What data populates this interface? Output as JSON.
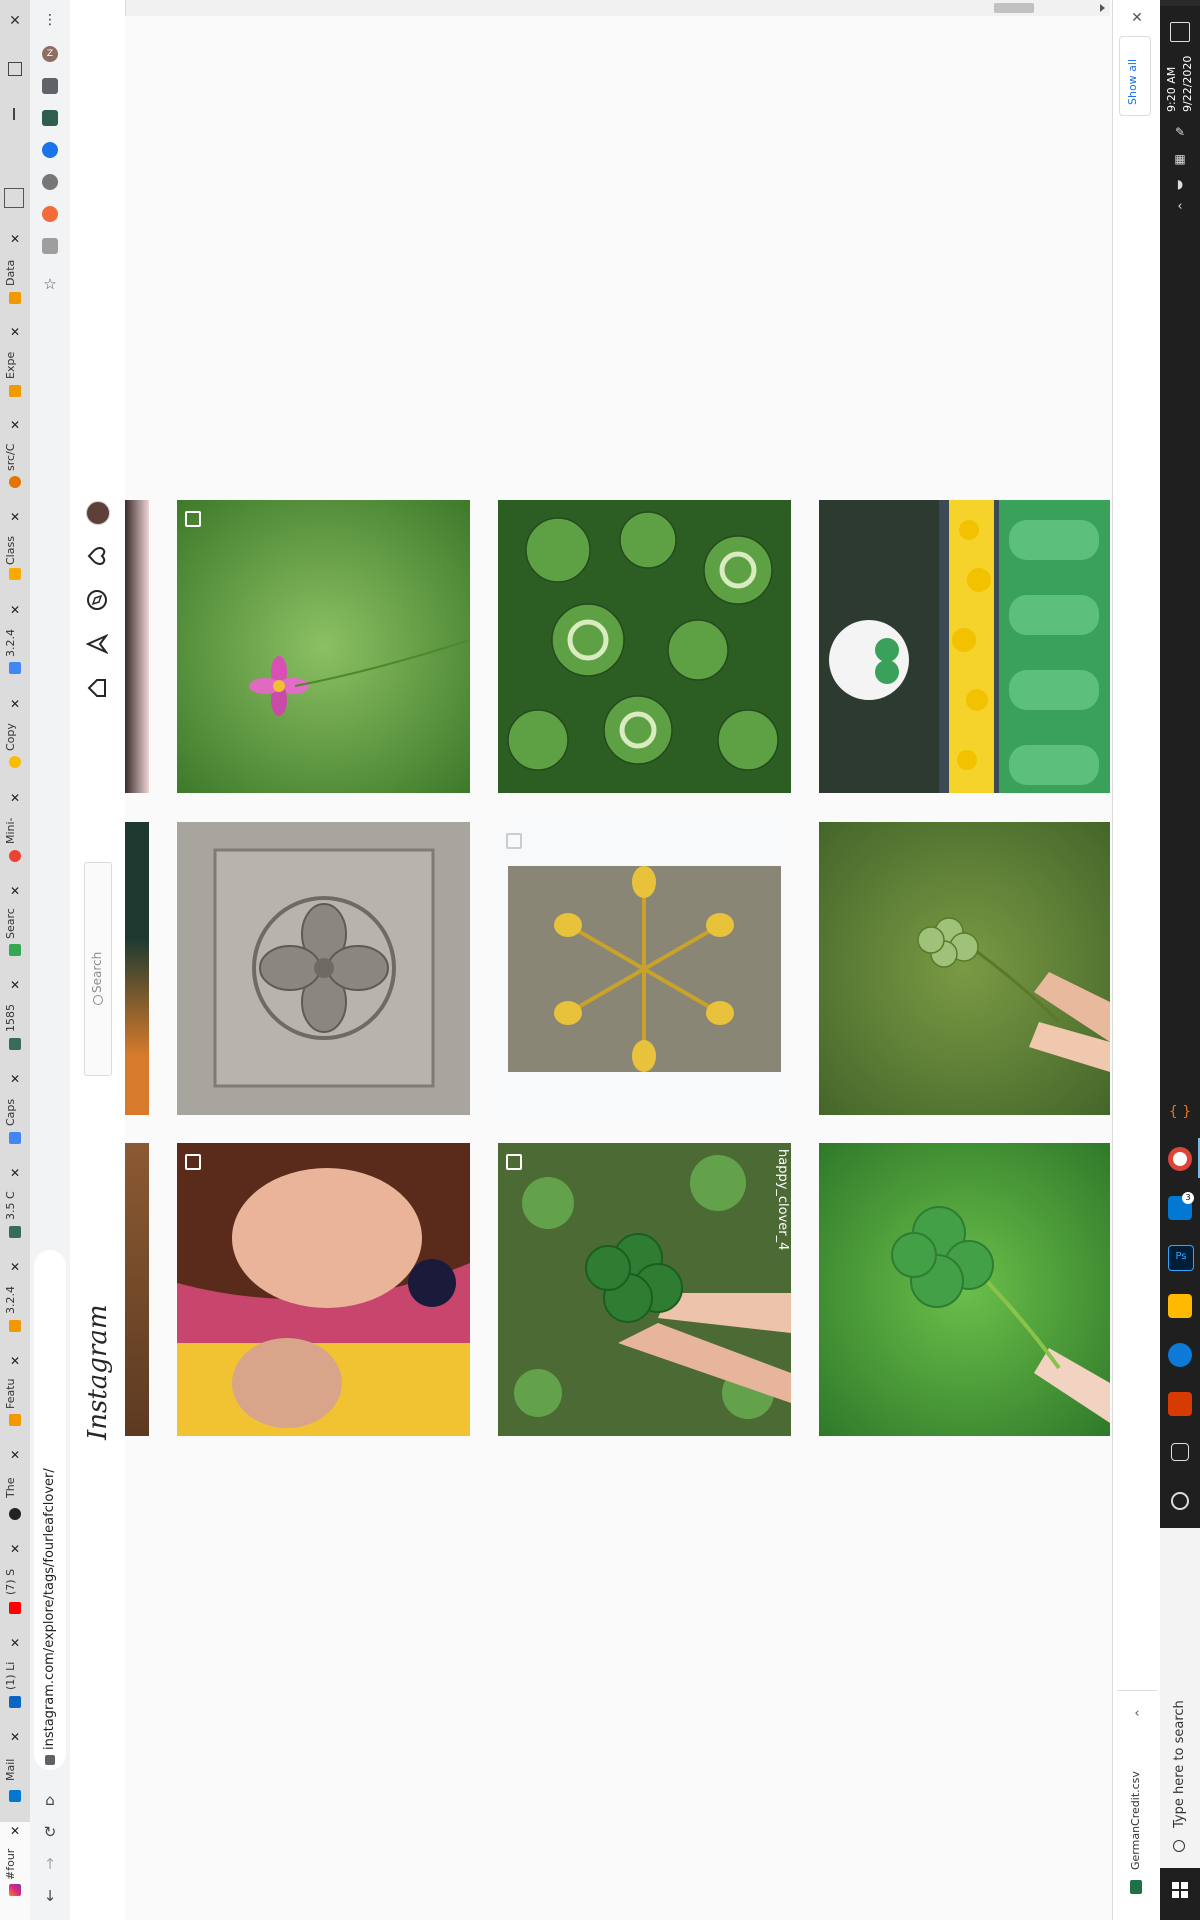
{
  "browser": {
    "url": "instagram.com/explore/tags/fourleafclover/",
    "tabs": [
      {
        "label": "#four"
      },
      {
        "label": "Mail"
      },
      {
        "label": "(1) Li"
      },
      {
        "label": "(7) S"
      },
      {
        "label": "The"
      },
      {
        "label": "Featu"
      },
      {
        "label": "3.2.4"
      },
      {
        "label": "3.5 C"
      },
      {
        "label": "Caps"
      },
      {
        "label": "1585"
      },
      {
        "label": "Searc"
      },
      {
        "label": "Mini-"
      },
      {
        "label": "Copy"
      },
      {
        "label": "3.2.4"
      },
      {
        "label": "Class"
      },
      {
        "label": "src/C"
      },
      {
        "label": "Expe"
      },
      {
        "label": "Data"
      }
    ],
    "profile_initial": "Z"
  },
  "instagram": {
    "logo": "Instagram",
    "search_placeholder": "Search",
    "hashtag_overlay": "happy_clover_4"
  },
  "downloads": {
    "show_all": "Show all",
    "file": "GermanCredit.csv"
  },
  "taskbar": {
    "search_placeholder": "Type here to search",
    "time": "9:20 AM",
    "date": "9/22/2020",
    "mail_badge": "3"
  },
  "colors": {
    "accent": "#1a73e8",
    "taskbar": "#1f1f1f"
  }
}
